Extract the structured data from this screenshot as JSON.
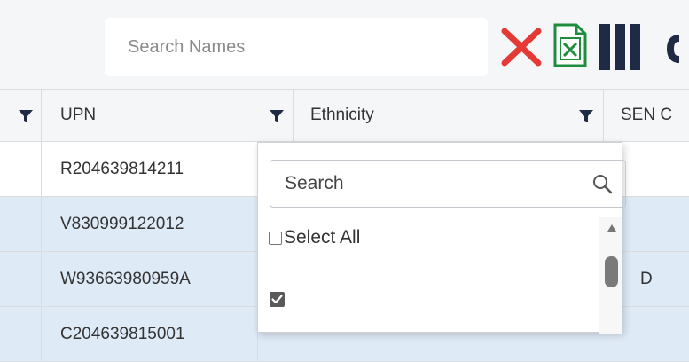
{
  "toolbar": {
    "search_placeholder": "Search Names",
    "icons": [
      "close-icon",
      "excel-icon",
      "columns-icon"
    ],
    "accent_red": "#e53935",
    "excel_green": "#1e8e3e"
  },
  "grid": {
    "columns": [
      {
        "label": "UPN"
      },
      {
        "label": "Ethnicity"
      },
      {
        "label": "SEN C"
      }
    ],
    "rows": [
      {
        "upn": "R204639814211",
        "trailing": ""
      },
      {
        "upn": "V830999122012",
        "trailing": ""
      },
      {
        "upn": "W93663980959A",
        "trailing": "D"
      },
      {
        "upn": "C204639815001",
        "trailing": ""
      }
    ],
    "row_alt_color": "#dfeaf7"
  },
  "filter_popup": {
    "search_placeholder": "Search",
    "select_all_label": "Select All",
    "select_all_checked": false,
    "first_item_checked": true
  }
}
